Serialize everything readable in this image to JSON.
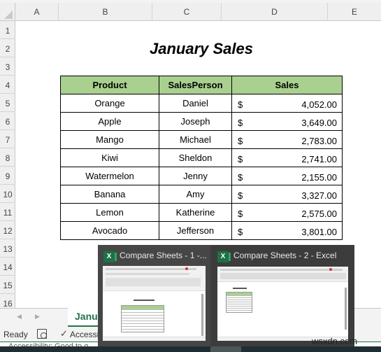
{
  "sheet": {
    "columns": [
      "A",
      "B",
      "C",
      "D",
      "E"
    ],
    "rows": [
      "1",
      "2",
      "3",
      "4",
      "5",
      "6",
      "7",
      "8",
      "9",
      "10",
      "11",
      "12",
      "13",
      "14",
      "15",
      "16"
    ],
    "title": "January Sales",
    "table": {
      "headers": [
        "Product",
        "SalesPerson",
        "Sales"
      ],
      "currency_symbol": "$",
      "rows": [
        {
          "product": "Orange",
          "salesperson": "Daniel",
          "sales": "4,052.00"
        },
        {
          "product": "Apple",
          "salesperson": "Joseph",
          "sales": "3,649.00"
        },
        {
          "product": "Mango",
          "salesperson": "Michael",
          "sales": "2,783.00"
        },
        {
          "product": "Kiwi",
          "salesperson": "Sheldon",
          "sales": "2,741.00"
        },
        {
          "product": "Watermelon",
          "salesperson": "Jenny",
          "sales": "2,155.00"
        },
        {
          "product": "Banana",
          "salesperson": "Amy",
          "sales": "3,327.00"
        },
        {
          "product": "Lemon",
          "salesperson": "Katherine",
          "sales": "2,575.00"
        },
        {
          "product": "Avocado",
          "salesperson": "Jefferson",
          "sales": "3,801.00"
        }
      ],
      "header_color": "#a9d08e"
    }
  },
  "sheet_tabs": {
    "prev_icon": "triangle-left",
    "next_icon": "triangle-right",
    "active_tab": "Janua"
  },
  "status_bar": {
    "ready": "Ready",
    "macro_icon": "macro-record-icon",
    "accessibility_icon": "accessibility-icon",
    "accessibility": "Accessib",
    "accessibility_tooltip": "Accessibility: Good to g"
  },
  "taskbar_preview": {
    "windows": [
      {
        "app_icon": "X",
        "title": "Compare Sheets  -  1 -..."
      },
      {
        "app_icon": "X",
        "title": "Compare Sheets  -  2 - Excel"
      }
    ]
  },
  "watermark": "wsxdn.com",
  "colors": {
    "excel_green": "#217346",
    "header_green": "#a9d08e",
    "preview_bg": "#3c3c3c",
    "taskbar": "#1f2e33"
  }
}
